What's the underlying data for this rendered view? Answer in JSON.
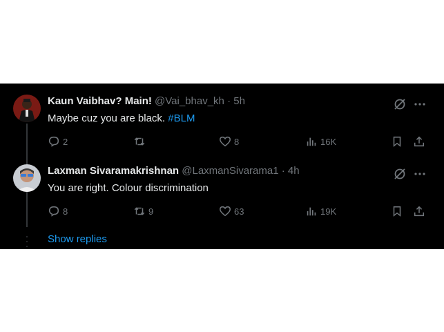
{
  "tweets": [
    {
      "display_name": "Kaun Vaibhav? Main!",
      "handle": "@Vai_bhav_kh",
      "separator": "·",
      "time": "5h",
      "text": "Maybe cuz you are black. ",
      "hashtag": "#BLM",
      "replies": "2",
      "retweets": "",
      "likes": "8",
      "views": "16K"
    },
    {
      "display_name": "Laxman Sivaramakrishnan",
      "handle": "@LaxmanSivarama1",
      "separator": "·",
      "time": "4h",
      "text": "You are right. Colour discrimination",
      "hashtag": "",
      "replies": "8",
      "retweets": "9",
      "likes": "63",
      "views": "19K"
    }
  ],
  "show_replies_label": "Show replies",
  "colors": {
    "background": "#000000",
    "text": "#e7e9ea",
    "muted": "#71767b",
    "accent": "#1d9bf0"
  },
  "icons": [
    "grok-icon",
    "more-icon",
    "reply-icon",
    "retweet-icon",
    "like-icon",
    "views-icon",
    "bookmark-icon",
    "share-icon"
  ]
}
